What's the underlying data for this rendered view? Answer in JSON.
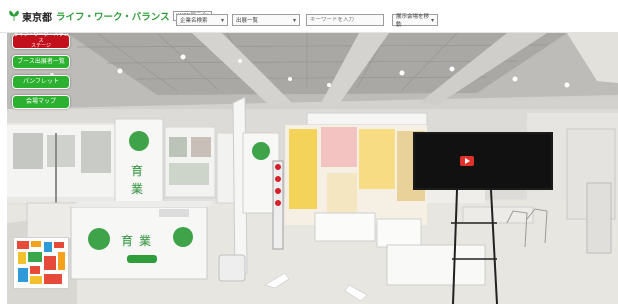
{
  "header": {
    "logo_text": "東京都",
    "title": "ライフ・ワーク・バランス",
    "subtitle": "(WEB展示会)",
    "select_1": "企業名検索",
    "select_2": "出展一覧",
    "search_placeholder": "キーワードを入力",
    "select_3": "展示会場を移動"
  },
  "menu": {
    "red_button_line1": "ライフ・ワーク・バランス",
    "red_button_line2": "ステージ",
    "green_buttons": [
      "ブース出展者一覧",
      "パンフレット",
      "会場マップ"
    ]
  },
  "colors": {
    "brand_green": "#2f9e3a",
    "menu_red": "#c2101d",
    "menu_green": "#2bb02f"
  }
}
